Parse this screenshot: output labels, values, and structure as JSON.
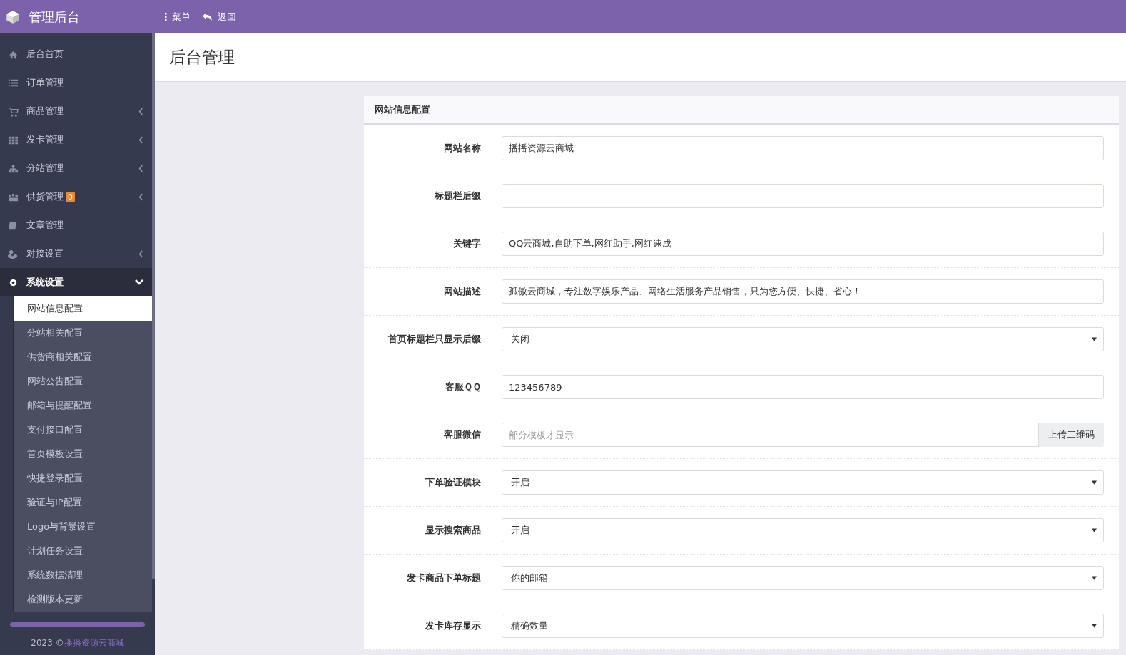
{
  "topbar": {
    "brand": "管理后台",
    "actions": [
      {
        "label": "菜单"
      },
      {
        "label": "返回"
      }
    ]
  },
  "sidebar": {
    "items": [
      {
        "label": "后台首页",
        "expandable": false,
        "selected": false
      },
      {
        "label": "订单管理",
        "expandable": false,
        "selected": false
      },
      {
        "label": "商品管理",
        "expandable": true,
        "expanded": false,
        "selected": false
      },
      {
        "label": "发卡管理",
        "expandable": true,
        "expanded": false,
        "selected": false
      },
      {
        "label": "分站管理",
        "expandable": true,
        "expanded": false,
        "selected": false
      },
      {
        "label": "供货管理",
        "badge": "0",
        "expandable": true,
        "expanded": false,
        "selected": false
      },
      {
        "label": "文章管理",
        "expandable": false,
        "selected": false
      },
      {
        "label": "对接设置",
        "expandable": true,
        "expanded": false,
        "selected": false
      },
      {
        "label": "系统设置",
        "expandable": true,
        "expanded": true,
        "selected": true,
        "children": [
          {
            "label": "网站信息配置",
            "selected": true
          },
          {
            "label": "分站相关配置",
            "selected": false
          },
          {
            "label": "供货商相关配置",
            "selected": false
          },
          {
            "label": "网站公告配置",
            "selected": false
          },
          {
            "label": "邮箱与提醒配置",
            "selected": false
          },
          {
            "label": "支付接口配置",
            "selected": false
          },
          {
            "label": "首页模板设置",
            "selected": false
          },
          {
            "label": "快捷登录配置",
            "selected": false
          },
          {
            "label": "验证与IP配置",
            "selected": false
          },
          {
            "label": "Logo与背景设置",
            "selected": false
          },
          {
            "label": "计划任务设置",
            "selected": false
          },
          {
            "label": "系统数据清理",
            "selected": false
          },
          {
            "label": "检测版本更新",
            "selected": false
          }
        ]
      }
    ],
    "footer": {
      "year": "2023 ©",
      "link": "播播资源云商城"
    }
  },
  "page": {
    "title": "后台管理"
  },
  "panel": {
    "title": "网站信息配置",
    "fields": [
      {
        "label": "网站名称",
        "kind": "text",
        "value": "播播资源云商城"
      },
      {
        "label": "标题栏后缀",
        "kind": "text"
      },
      {
        "label": "关键字",
        "kind": "text",
        "value": "QQ云商城,自助下单,网红助手,网红速成"
      },
      {
        "label": "网站描述",
        "kind": "text",
        "value": "孤傲云商城，专注数字娱乐产品、网络生活服务产品销售，只为您方便、快捷、省心！"
      },
      {
        "label": "首页标题栏只显示后缀",
        "kind": "select",
        "value": "关闭"
      },
      {
        "label": "客服ＱＱ",
        "kind": "text",
        "value": "123456789"
      },
      {
        "label": "客服微信",
        "kind": "upload",
        "placeholder": "部分模板才显示",
        "button": "上传二维码"
      },
      {
        "label": "下单验证模块",
        "kind": "select",
        "value": "开启"
      },
      {
        "label": "显示搜索商品",
        "kind": "select",
        "value": "开启"
      },
      {
        "label": "发卡商品下单标题",
        "kind": "select",
        "value": "你的邮箱"
      },
      {
        "label": "发卡库存显示",
        "kind": "select",
        "value": "精确数量"
      }
    ]
  }
}
